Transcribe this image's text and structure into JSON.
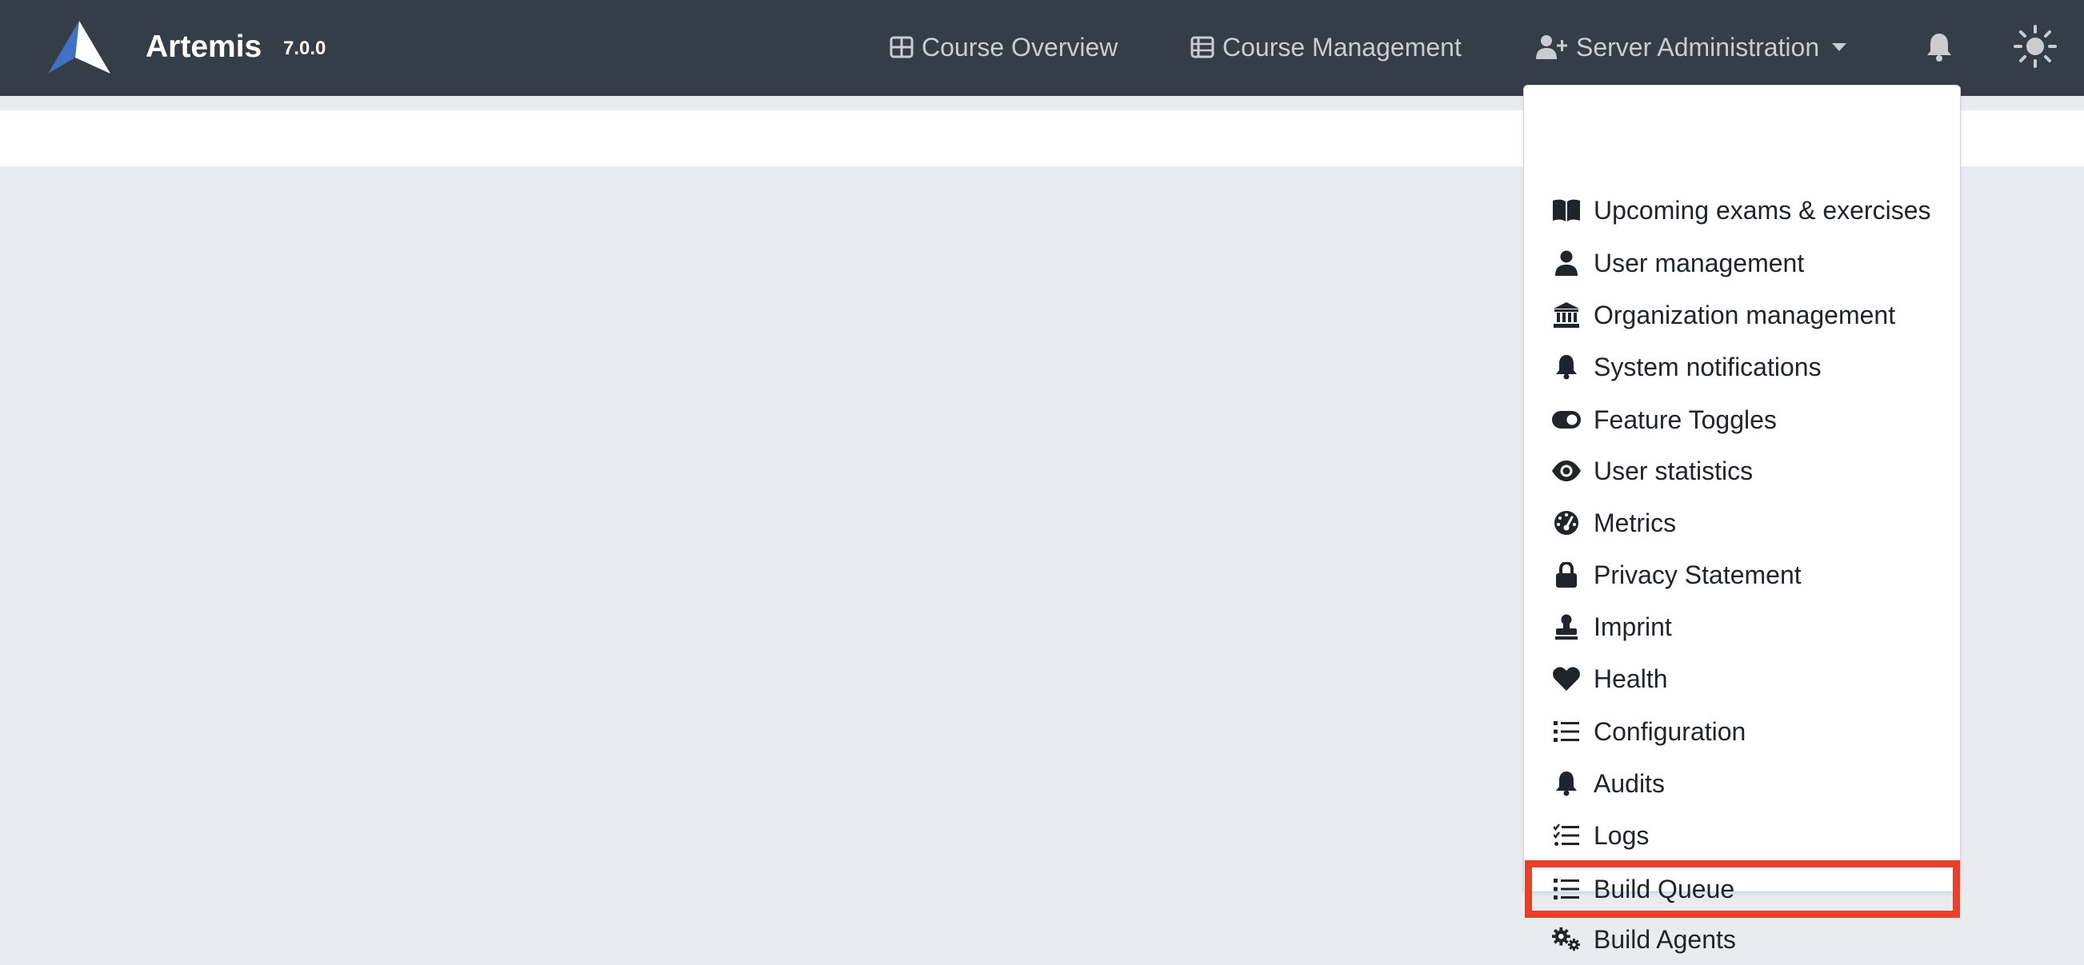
{
  "brand": {
    "name": "Artemis",
    "version": "7.0.0"
  },
  "nav": {
    "course_overview": "Course Overview",
    "course_management": "Course Management",
    "server_administration": "Server Administration"
  },
  "dropdown": {
    "highlight_color": "#e8402b",
    "items": [
      {
        "label": "Upcoming exams & exercises",
        "icon": "book-open-icon"
      },
      {
        "label": "User management",
        "icon": "user-icon"
      },
      {
        "label": "Organization management",
        "icon": "university-icon"
      },
      {
        "label": "System notifications",
        "icon": "bell-icon"
      },
      {
        "label": "Feature Toggles",
        "icon": "toggle-on-icon"
      },
      {
        "label": "User statistics",
        "icon": "eye-icon"
      },
      {
        "label": "Metrics",
        "icon": "tachometer-icon"
      },
      {
        "label": "Privacy Statement",
        "icon": "lock-icon"
      },
      {
        "label": "Imprint",
        "icon": "stamp-icon"
      },
      {
        "label": "Health",
        "icon": "heart-icon"
      },
      {
        "label": "Configuration",
        "icon": "list-icon"
      },
      {
        "label": "Audits",
        "icon": "bell-icon"
      },
      {
        "label": "Logs",
        "icon": "tasks-icon"
      },
      {
        "label": "Build Queue",
        "icon": "list-icon",
        "highlighted": true
      },
      {
        "label": "Build Agents",
        "icon": "cogs-icon"
      }
    ]
  }
}
